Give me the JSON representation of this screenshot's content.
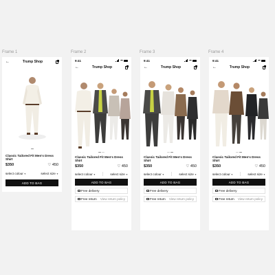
{
  "frames": [
    {
      "label": "Frame 1",
      "status_time": "",
      "models": 1
    },
    {
      "label": "Frame 2",
      "status_time": "9:41",
      "models": 4
    },
    {
      "label": "Frame 3",
      "status_time": "9:41",
      "models": 5
    },
    {
      "label": "Frame 4",
      "status_time": "9:41",
      "models": 5
    }
  ],
  "app": {
    "title": "Trump Shop",
    "back_icon": "arrow-left-icon",
    "bag_icon": "shopping-bag-icon"
  },
  "product": {
    "name": "Classic Tailored Fit Men's Dress Shirt",
    "price": "$350",
    "likes": "450",
    "heart_icon": "heart-icon"
  },
  "selectors": {
    "colour": "select colour",
    "size": "select size"
  },
  "actions": {
    "add_to_bag": "ADD TO BAG"
  },
  "info": {
    "delivery": "Free delivery",
    "returns": "Free return",
    "return_policy": "View return policy"
  },
  "colors": {
    "background": "#f2f2f2",
    "accent": "#111111",
    "muted": "#8a8a8a"
  }
}
